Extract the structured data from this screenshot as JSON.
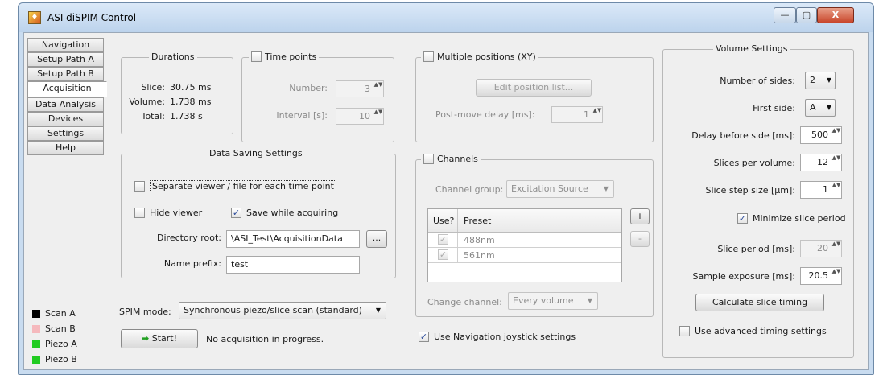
{
  "window": {
    "title": "ASI diSPIM Control",
    "minimize": "—",
    "maximize": "▢",
    "close": "X"
  },
  "tabs": [
    "Navigation",
    "Setup Path A",
    "Setup Path B",
    "Acquisition",
    "Data Analysis",
    "Devices",
    "Settings",
    "Help"
  ],
  "active_tab": "Acquisition",
  "legend": [
    {
      "label": "Scan A",
      "color": "#000000"
    },
    {
      "label": "Scan B",
      "color": "#f5b9bd"
    },
    {
      "label": "Piezo A",
      "color": "#22cc22"
    },
    {
      "label": "Piezo B",
      "color": "#22cc22"
    }
  ],
  "durations": {
    "title": "Durations",
    "slice_label": "Slice:",
    "slice_value": "30.75 ms",
    "volume_label": "Volume:",
    "volume_value": "1,738 ms",
    "total_label": "Total:",
    "total_value": "1.738 s"
  },
  "time_points": {
    "title": "Time points",
    "number_label": "Number:",
    "number_value": "3",
    "interval_label": "Interval [s]:",
    "interval_value": "10"
  },
  "data_saving": {
    "title": "Data Saving Settings",
    "separate_viewer": "Separate viewer / file for each time point",
    "hide_viewer": "Hide viewer",
    "save_while_acquiring": "Save while acquiring",
    "directory_label": "Directory root:",
    "directory_value": "\\ASI_Test\\AcquisitionData",
    "browse": "...",
    "prefix_label": "Name prefix:",
    "prefix_value": "test"
  },
  "spim": {
    "mode_label": "SPIM mode:",
    "mode_value": "Synchronous piezo/slice scan (standard)",
    "start_label": "Start!",
    "status": "No acquisition in progress."
  },
  "positions": {
    "title": "Multiple positions (XY)",
    "edit_button": "Edit position list...",
    "delay_label": "Post-move delay [ms]:",
    "delay_value": "1"
  },
  "channels": {
    "title": "Channels",
    "group_label": "Channel group:",
    "group_value": "Excitation Source",
    "col_use": "Use?",
    "col_preset": "Preset",
    "rows": [
      {
        "use": "✓",
        "preset": "488nm"
      },
      {
        "use": "✓",
        "preset": "561nm"
      }
    ],
    "add": "+",
    "remove": "-",
    "change_label": "Change channel:",
    "change_value": "Every volume"
  },
  "joystick": "Use Navigation joystick settings",
  "volume": {
    "title": "Volume Settings",
    "sides_label": "Number of sides:",
    "sides_value": "2",
    "first_side_label": "First side:",
    "first_side_value": "A",
    "delay_label": "Delay before side [ms]:",
    "delay_value": "500",
    "slices_label": "Slices per volume:",
    "slices_value": "12",
    "step_label": "Slice step size [µm]:",
    "step_value": "1",
    "minimize_label": "Minimize slice period",
    "period_label": "Slice period [ms]:",
    "period_value": "20",
    "exposure_label": "Sample exposure [ms]:",
    "exposure_value": "20.5",
    "calc_button": "Calculate slice timing",
    "advanced_label": "Use advanced timing settings"
  },
  "icons": {
    "checked": "✓",
    "spin": "▲▼",
    "dropdown": "▼",
    "start_arrow": "➡"
  }
}
